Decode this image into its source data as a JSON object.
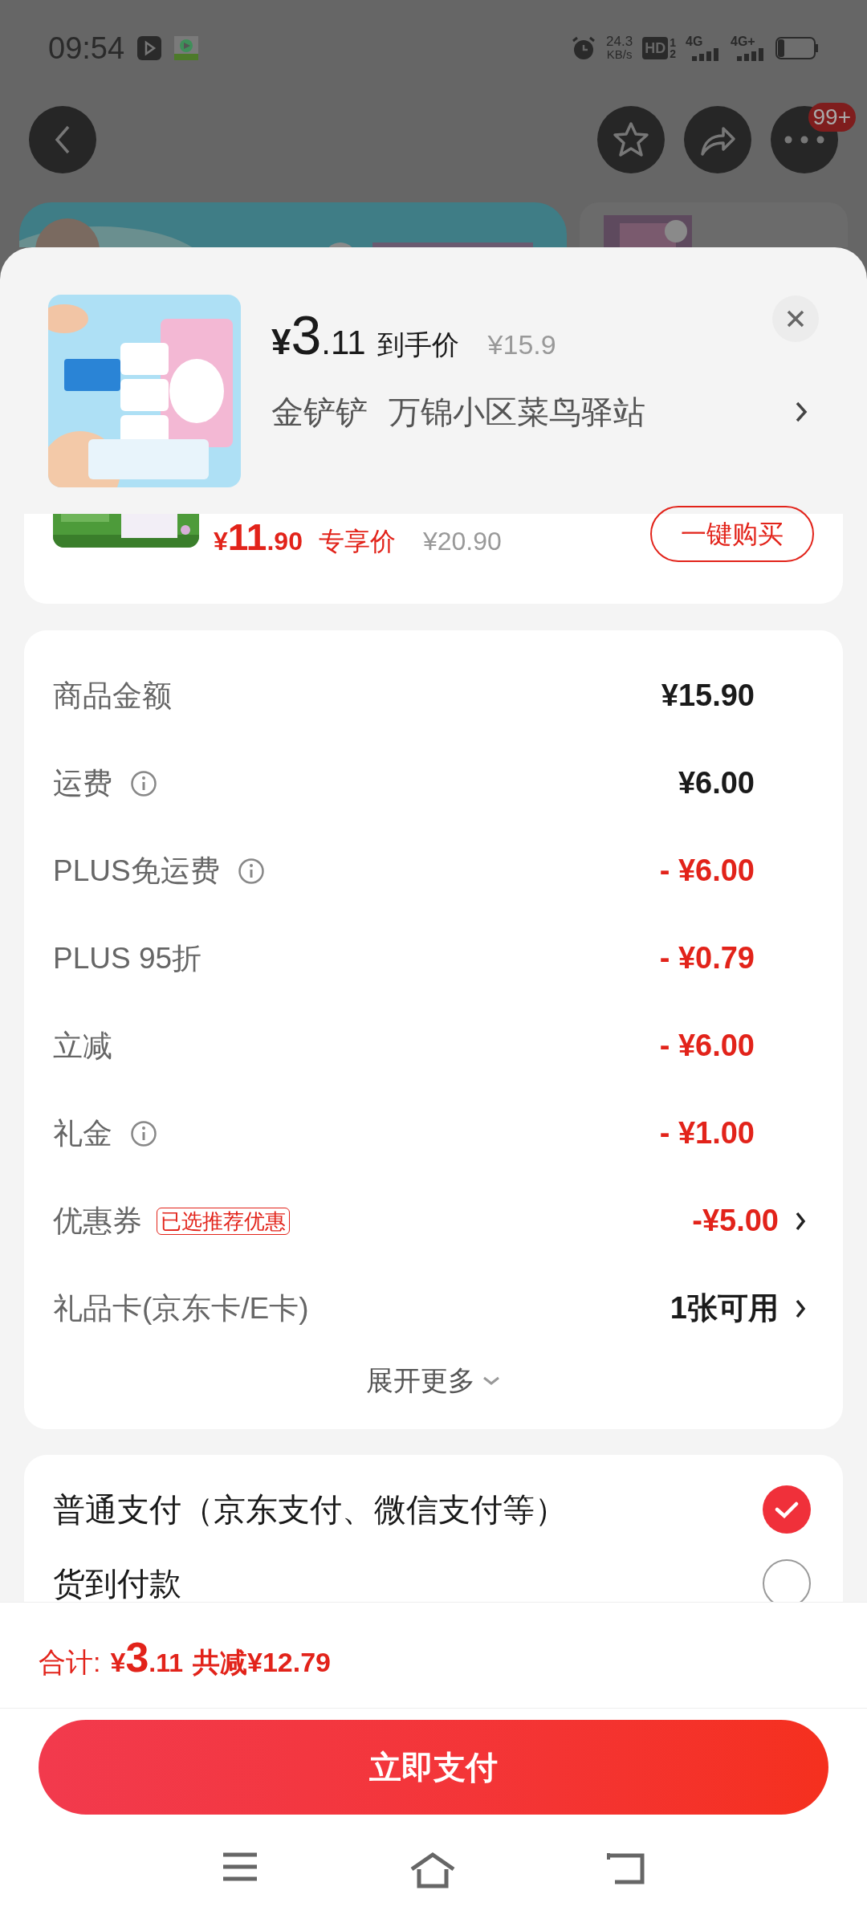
{
  "status_bar": {
    "time": "09:54",
    "speed": "24.3",
    "speed_unit": "KB/s",
    "hd": "HD",
    "sim_1": "1",
    "sim_2": "2",
    "network_1": "4G",
    "network_2": "4G+"
  },
  "top_bar": {
    "badge": "99+"
  },
  "product": {
    "currency": "¥",
    "integer": "3",
    "decimal": ".11",
    "price_label": "到手价",
    "original_price": "¥15.9",
    "shop": "金铲铲",
    "pickup": "万锦小区菜鸟驿站"
  },
  "offer": {
    "currency": "¥",
    "integer": "11",
    "decimal": ".90",
    "price_label": "专享价",
    "original_price": "¥20.90",
    "button": "一键购买"
  },
  "fees": [
    {
      "label": "商品金额",
      "info": false,
      "value": "¥15.90",
      "kind": "plain",
      "arrow": false
    },
    {
      "label": "运费",
      "info": true,
      "value": "¥6.00",
      "kind": "plain",
      "arrow": false
    },
    {
      "label": "PLUS免运费",
      "info": true,
      "value": "- ¥6.00",
      "kind": "discount",
      "arrow": false
    },
    {
      "label": "PLUS 95折",
      "info": false,
      "value": "- ¥0.79",
      "kind": "discount",
      "arrow": false
    },
    {
      "label": "立减",
      "info": false,
      "value": "- ¥6.00",
      "kind": "discount",
      "arrow": false
    },
    {
      "label": "礼金",
      "info": true,
      "value": "- ¥1.00",
      "kind": "discount",
      "arrow": false
    },
    {
      "label": "优惠券",
      "info": false,
      "tag": "已选推荐优惠",
      "value": "-¥5.00",
      "kind": "discount",
      "arrow": true
    },
    {
      "label": "礼品卡(京东卡/E卡)",
      "info": false,
      "value": "1张可用",
      "kind": "plain",
      "arrow": true
    }
  ],
  "expand": "展开更多",
  "payment_options": [
    {
      "label": "普通支付（京东支付、微信支付等）",
      "selected": true
    },
    {
      "label": "货到付款",
      "selected": false
    }
  ],
  "total": {
    "label": "合计:",
    "currency": "¥",
    "integer": "3",
    "decimal": ".11",
    "saved": "共减¥12.79"
  },
  "pay_button": "立即支付"
}
